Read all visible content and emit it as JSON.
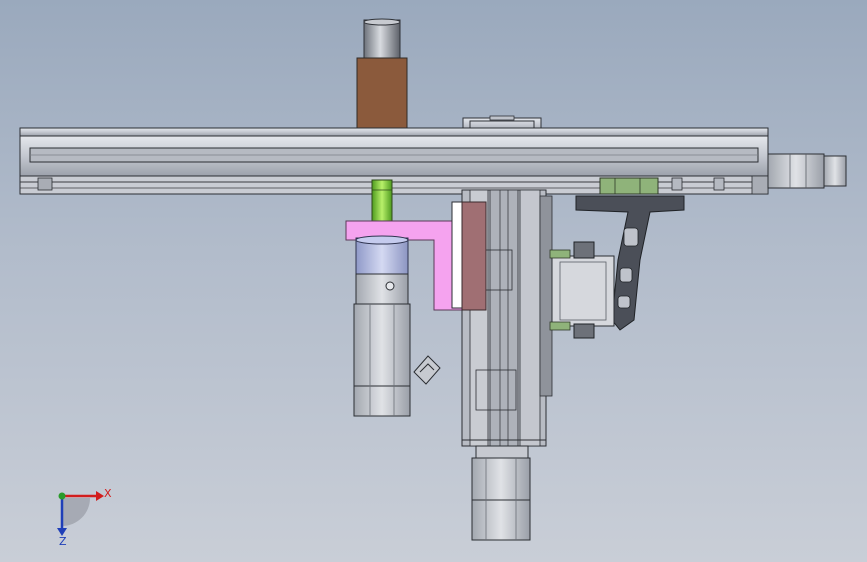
{
  "scene": {
    "background_top": "#9aa9bd",
    "background_bottom": "#c9ced7"
  },
  "parts": {
    "rail_color": "#c8ccd4",
    "coupling_color": "#8b5a3c",
    "green_shaft_color": "#7fd13b",
    "pink_bracket_color": "#f5a3ef",
    "motor_blue": "#aeb8e6",
    "plate_maroon": "#a06f73",
    "arm_dark": "#4b4f58",
    "bracket_green": "#8fb37a"
  },
  "triad": {
    "x_label": "X",
    "z_label": "Z",
    "x_color": "#d21d1d",
    "y_color": "#2a9b2a",
    "z_color": "#1f3fb8"
  }
}
